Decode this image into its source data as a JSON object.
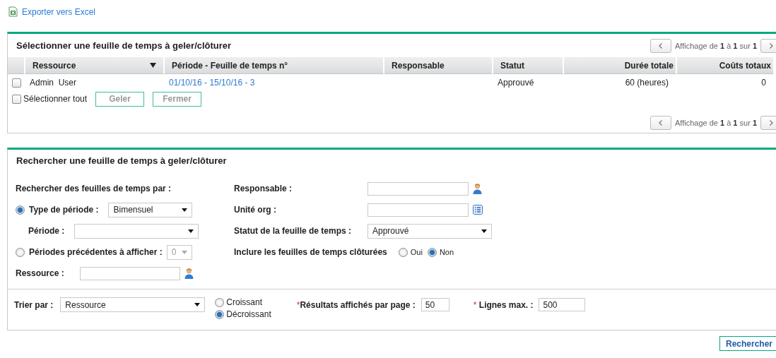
{
  "export_link": "Exporter vers Excel",
  "results": {
    "title": "Sélectionner une feuille de temps à geler/clôturer",
    "pager_top": "Affichage de **1** à **1** sur **1**",
    "columns": [
      {
        "label": "Ressource",
        "kind": "text",
        "sorted": true
      },
      {
        "label": "Période - Feuille de temps n°",
        "kind": "text",
        "sorted": false
      },
      {
        "label": "Responsable",
        "kind": "text",
        "sorted": false
      },
      {
        "label": "Statut",
        "kind": "text",
        "sorted": false
      },
      {
        "label": "Durée totale",
        "kind": "number",
        "sorted": false
      },
      {
        "label": "Coûts totaux",
        "kind": "number",
        "sorted": false
      }
    ],
    "rows": [
      {
        "checked": false,
        "resource": "Admin  User",
        "period": "01/10/16 - 15/10/16 - 3",
        "status": "Approuvé",
        "duration": "60 (heures)",
        "cost": "0"
      }
    ],
    "select_all": {
      "label": "Sélectionner tout",
      "checked": false
    },
    "buttons": [
      {
        "label": "Geler",
        "disabled": true
      },
      {
        "label": "Fermer",
        "disabled": true
      }
    ],
    "pager_bottom": "Affichage de **1** à **1** sur **1**"
  },
  "search": {
    "title": "Rechercher une feuille de temps à geler/clôturer",
    "search_by": "Rechercher des feuilles de temps par :",
    "period_type": {
      "label": "Type de période :",
      "selected": true,
      "value": "Bimensuel"
    },
    "period": {
      "label": "Période :"
    },
    "previous_periods": {
      "label": "Périodes précédentes à afficher :",
      "selected": false,
      "value": "0",
      "disabled": true
    },
    "resource": {
      "label": "Ressource :"
    },
    "manager": {
      "label": "Responsable :"
    },
    "org_unit": {
      "label": "Unité org :"
    },
    "status": {
      "label": "Statut de la feuille de temps :",
      "value": "Approuvé"
    },
    "include_closed": {
      "label": "Inclure les feuilles de temps clôturées",
      "options": [
        {
          "label": "Oui",
          "selected": false
        },
        {
          "label": "Non",
          "selected": true
        }
      ]
    },
    "sort_by": {
      "label": "Trier par :",
      "value": "Ressource"
    },
    "order": [
      {
        "label": "Croissant",
        "selected": false
      },
      {
        "label": "Décroissant",
        "selected": true
      }
    ],
    "per_page": {
      "marker": "*",
      "label": "Résultats affichés par page :",
      "value": "50"
    },
    "max_rows": {
      "marker": "*",
      "label": "Lignes max. :",
      "value": "500"
    }
  },
  "search_button": "Rechercher"
}
